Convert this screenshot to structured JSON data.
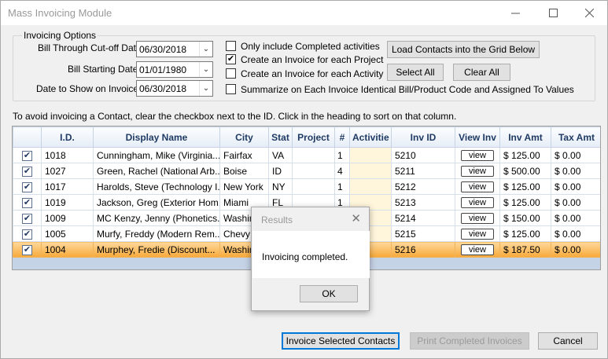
{
  "window": {
    "title": "Mass Invoicing Module",
    "minimize_icon": "minimize-icon",
    "maximize_icon": "maximize-icon",
    "close_icon": "close-icon"
  },
  "options": {
    "group_label": "Invoicing Options",
    "bill_through_label": "Bill Through Cut-off Date",
    "bill_through_value": "06/30/2018",
    "bill_starting_label": "Bill Starting Date",
    "bill_starting_value": "01/01/1980",
    "date_show_label": "Date to Show on Invoice",
    "date_show_value": "06/30/2018",
    "only_completed": {
      "label": "Only include Completed activities",
      "checked": false
    },
    "invoice_each_project": {
      "label": "Create an Invoice for each Project",
      "checked": true
    },
    "invoice_each_activity": {
      "label": "Create an Invoice for each Activity",
      "checked": false
    },
    "summarize": {
      "label": "Summarize on Each Invoice Identical Bill/Product Code and Assigned To Values",
      "checked": false
    },
    "load_contacts_label": "Load Contacts into the Grid Below",
    "select_all_label": "Select All",
    "clear_all_label": "Clear All"
  },
  "instructions": "To avoid invoicing a Contact, clear the checkbox next to the ID.  Click in the heading to sort on that column.",
  "grid": {
    "columns": [
      "",
      "I.D.",
      "Display Name",
      "City",
      "Stat",
      "Project",
      "#",
      "Activitie",
      "Inv ID",
      "View Inv",
      "Inv Amt",
      "Tax Amt"
    ],
    "view_label": "view",
    "rows": [
      {
        "id": "1018",
        "name": "Cunningham, Mike (Virginia...",
        "city": "Fairfax",
        "state": "VA",
        "project": "",
        "count": "1",
        "activities": "",
        "inv_id": "5210",
        "inv_amt": "$ 125.00",
        "tax_amt": "$ 0.00",
        "checked": true,
        "selected": false
      },
      {
        "id": "1027",
        "name": "Green, Rachel (National Arb...",
        "city": "Boise",
        "state": "ID",
        "project": "",
        "count": "4",
        "activities": "",
        "inv_id": "5211",
        "inv_amt": "$ 500.00",
        "tax_amt": "$ 0.00",
        "checked": true,
        "selected": false
      },
      {
        "id": "1017",
        "name": "Harolds, Steve (Technology I...",
        "city": "New York",
        "state": "NY",
        "project": "",
        "count": "1",
        "activities": "",
        "inv_id": "5212",
        "inv_amt": "$ 125.00",
        "tax_amt": "$ 0.00",
        "checked": true,
        "selected": false
      },
      {
        "id": "1019",
        "name": "Jackson, Greg (Exterior Hom...",
        "city": "Miami",
        "state": "FL",
        "project": "",
        "count": "1",
        "activities": "",
        "inv_id": "5213",
        "inv_amt": "$ 125.00",
        "tax_amt": "$ 0.00",
        "checked": true,
        "selected": false
      },
      {
        "id": "1009",
        "name": "MC Kenzy, Jenny (Phonetics...",
        "city": "Washing",
        "state": "",
        "project": "",
        "count": "",
        "activities": "",
        "inv_id": "5214",
        "inv_amt": "$ 150.00",
        "tax_amt": "$ 0.00",
        "checked": true,
        "selected": false
      },
      {
        "id": "1005",
        "name": "Murfy, Freddy (Modern Rem...",
        "city": "Chevy C",
        "state": "",
        "project": "",
        "count": "",
        "activities": "",
        "inv_id": "5215",
        "inv_amt": "$ 125.00",
        "tax_amt": "$ 0.00",
        "checked": true,
        "selected": false
      },
      {
        "id": "1004",
        "name": "Murphey, Fredie (Discount...",
        "city": "Washing",
        "state": "",
        "project": "",
        "count": "",
        "activities": "",
        "inv_id": "5216",
        "inv_amt": "$ 187.50",
        "tax_amt": "$ 0.00",
        "checked": true,
        "selected": true
      }
    ]
  },
  "dialog": {
    "title": "Results",
    "message": "Invoicing completed.",
    "ok_label": "OK"
  },
  "footer": {
    "invoice_selected_label": "Invoice Selected Contacts",
    "print_completed_label": "Print Completed Invoices",
    "cancel_label": "Cancel"
  }
}
